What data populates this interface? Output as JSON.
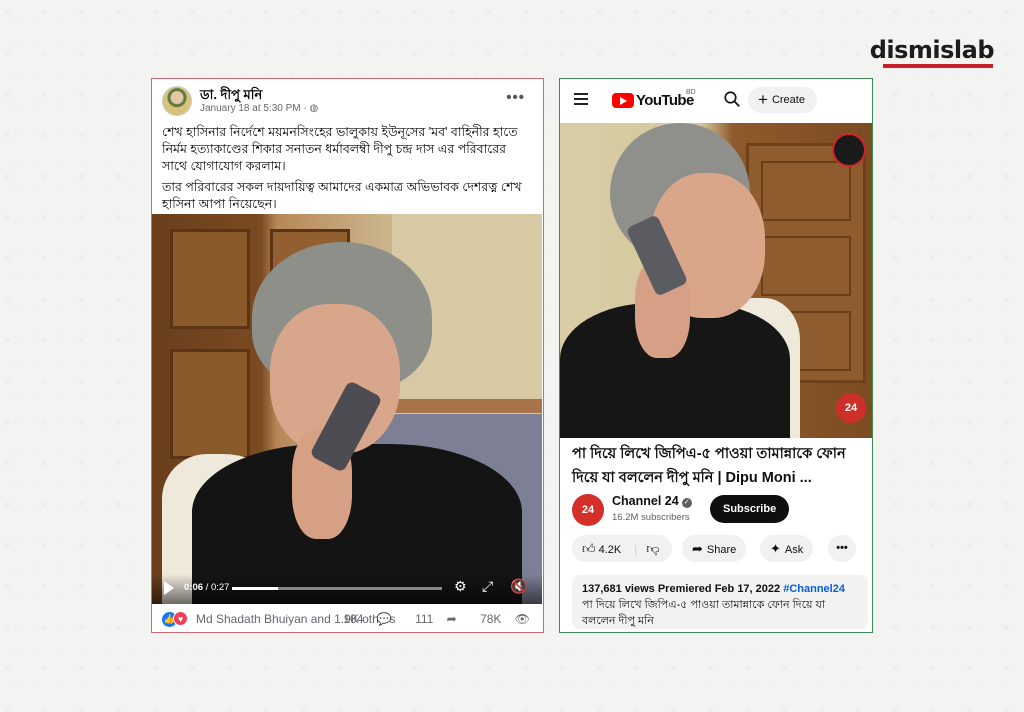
{
  "brand": {
    "logo_text": "dismislab"
  },
  "facebook": {
    "author": "ডা. দীপু মনি",
    "timestamp": "January 18 at 5:30 PM",
    "privacy_icon": "globe-icon",
    "post_text": [
      "শেখ হাসিনার নির্দেশে ময়মনসিংহের ভালুকায় ইউনূসের 'মব' বাহিনীর হাতে নির্মম হত্যাকাণ্ডের শিকার সনাতন ধর্মাবলম্বী দীপু চন্দ্র দাস এর পরিবারের সাথে যোগাযোগ করলাম।",
      "তার পরিবারের সকল দায়দায়িত্ব আমাদের একমাত্র অভিভাবক দেশরত্ন শেখ হাসিনা আপা নিয়েছেন।"
    ],
    "video": {
      "current_time": "0:06",
      "duration": "0:27",
      "progress": 0.22
    },
    "reactions_text": "Md Shadath Bhuiyan and 1.9K others",
    "comments": "104",
    "shares": "111",
    "views": "78K"
  },
  "youtube": {
    "wordmark": "YouTube",
    "country": "BD",
    "create_label": "Create",
    "video_title": "পা দিয়ে লিখে জিপিএ-৫ পাওয়া তামান্নাকে ফোন দিয়ে যা বললেন দীপু মনি | Dipu Moni ...",
    "channel_avatar_text": "24",
    "channel_name": "Channel 24",
    "subscribers": "16.2M subscribers",
    "subscribe_label": "Subscribe",
    "likes": "4.2K",
    "share_label": "Share",
    "ask_label": "Ask",
    "description_meta": "137,681 views  Premiered Feb 17, 2022",
    "hashtag": "#Channel24",
    "description_text": "পা দিয়ে লিখে জিপিএ-৫ পাওয়া তামান্নাকে ফোন দিয়ে যা বললেন দীপু মনি",
    "badge_text": "24"
  },
  "colors": {
    "facebook_border": "#c96a78",
    "youtube_border": "#3f8a56",
    "brand_red": "#c8202a",
    "youtube_red": "#ff0000",
    "link_blue": "#065fd4"
  }
}
